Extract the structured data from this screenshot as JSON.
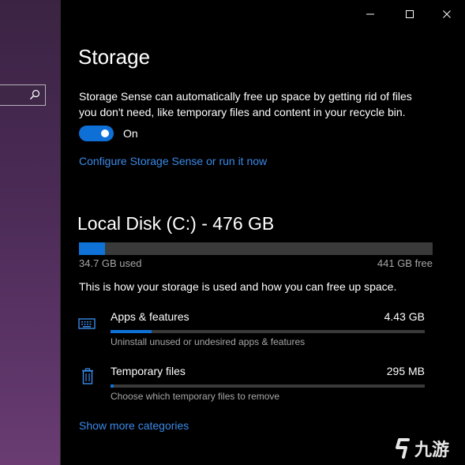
{
  "sidebar": {
    "search_icon": "search-icon"
  },
  "window": {
    "controls": [
      "minimize-icon",
      "maximize-icon",
      "close-icon"
    ]
  },
  "storage": {
    "title": "Storage",
    "description": "Storage Sense can automatically free up space by getting rid of files you don't need, like temporary files and content in your recycle bin.",
    "toggle_state": "On",
    "toggle_on": true,
    "configure_link": "Configure Storage Sense or run it now"
  },
  "disk": {
    "title": "Local Disk (C:) - 476 GB",
    "used_label": "34.7 GB used",
    "free_label": "441 GB free",
    "used_fraction": 0.073,
    "usage_note": "This is how your storage is used and how you can free up space."
  },
  "categories": [
    {
      "name": "Apps & features",
      "size": "4.43 GB",
      "fraction": 0.13,
      "subtitle": "Uninstall unused or undesired apps & features",
      "icon": "keyboard-icon"
    },
    {
      "name": "Temporary files",
      "size": "295 MB",
      "fraction": 0.01,
      "subtitle": "Choose which temporary files to remove",
      "icon": "trash-icon"
    }
  ],
  "more_link": "Show more categories",
  "watermark": "九游",
  "colors": {
    "accent": "#0f72d6",
    "link": "#3a8ae8",
    "sidebar": "#4a2a55"
  }
}
